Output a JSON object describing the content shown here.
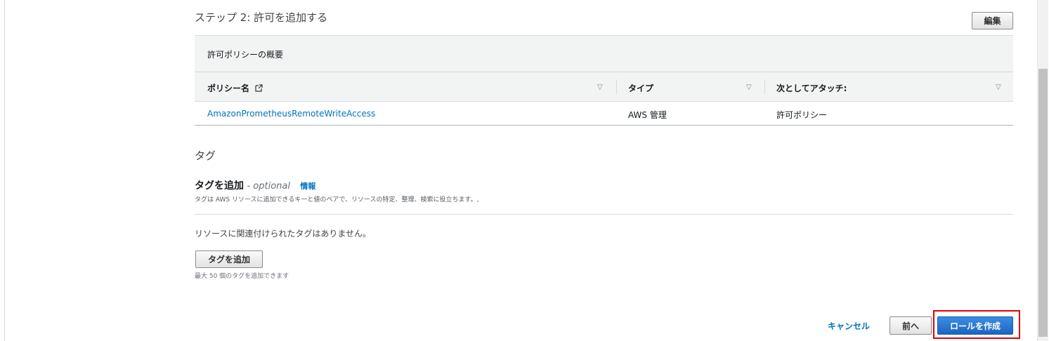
{
  "step": {
    "title": "ステップ 2: 許可を追加する",
    "edit_label": "編集"
  },
  "policy": {
    "summary_label": "許可ポリシーの概要",
    "columns": [
      {
        "label": "ポリシー名"
      },
      {
        "label": "タイプ"
      },
      {
        "label": "次としてアタッチ:"
      }
    ],
    "rows": [
      {
        "name": "AmazonPrometheusRemoteWriteAccess",
        "type": "AWS 管理",
        "attached_as": "許可ポリシー"
      }
    ],
    "external_link_icon": "external-link-icon",
    "sort_icon": "sort-caret-icon"
  },
  "tags": {
    "heading": "タグ",
    "add_title": "タグを追加",
    "optional": "- optional",
    "info_link": "情報",
    "description": "タグは AWS リソースに追加できるキーと値のペアで、リソースの特定、整理、検索に役立ちます。,",
    "empty_text": "リソースに関連付けられたタグはありません。",
    "add_button": "タグを追加",
    "max_text": "最大 50 個のタグを追加できます"
  },
  "footer": {
    "cancel_label": "キャンセル",
    "back_label": "前へ",
    "create_label": "ロールを作成"
  },
  "colors": {
    "link": "#0073bb",
    "primary": "#1d64c2",
    "highlight": "#e00000",
    "header_bg": "#f2f3f3"
  }
}
